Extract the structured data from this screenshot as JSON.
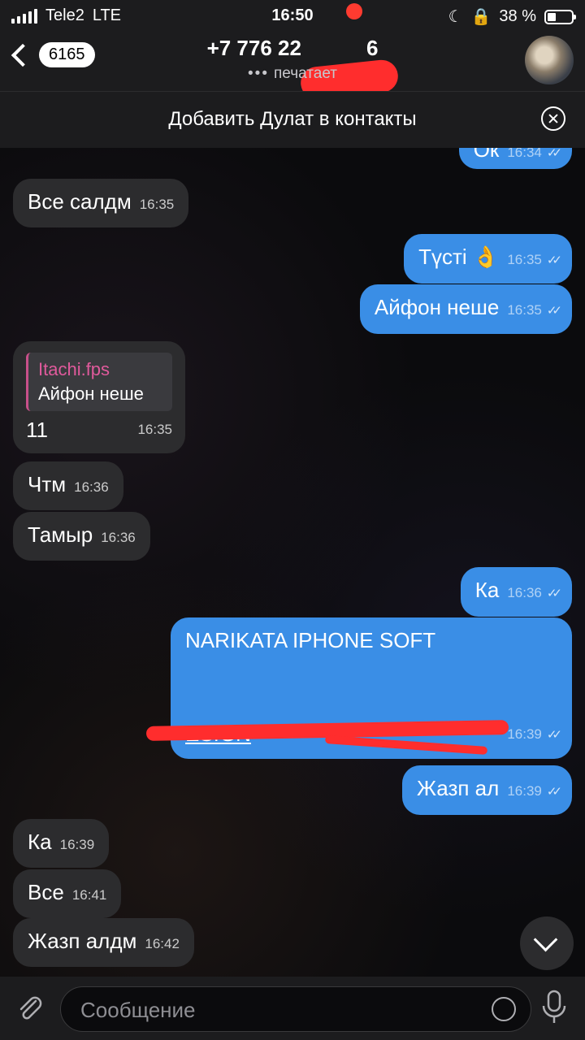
{
  "status_bar": {
    "carrier": "Tele2",
    "network": "LTE",
    "time": "16:50",
    "battery": "38 %"
  },
  "header": {
    "back_count": "6165",
    "title": "+7 776 22",
    "title_suffix": "6",
    "subtitle_dots": "•••",
    "subtitle": "печатает"
  },
  "contact_bar": {
    "label": "Добавить Дулат в контакты"
  },
  "messages": [
    {
      "text": "Ок",
      "time": "16:34"
    },
    {
      "text": "Все салдм",
      "time": "16:35"
    },
    {
      "text": "Түсті 👌",
      "time": "16:35"
    },
    {
      "text": "Айфон неше",
      "time": "16:35"
    },
    {
      "reply_author": "Itachi.fps",
      "reply_text": "Айфон неше",
      "text": "11",
      "time": "16:35"
    },
    {
      "text": "Чтм",
      "time": "16:36"
    },
    {
      "text": "Тамыр",
      "time": "16:36"
    },
    {
      "text": "Ка",
      "time": "16:36"
    },
    {
      "text": "NARIKATA IPHONE SOFT",
      "link_text": "ESIGN",
      "time": "16:39"
    },
    {
      "text": "Жазп ал",
      "time": "16:39"
    },
    {
      "text": "Ка",
      "time": "16:39"
    },
    {
      "text": "Все",
      "time": "16:41"
    },
    {
      "text": "Жазп алдм",
      "time": "16:42"
    }
  ],
  "input": {
    "placeholder": "Сообщение"
  },
  "colors": {
    "outgoing": "#3a8ee6",
    "incoming": "#2c2c2e",
    "redaction": "#ff2d2d"
  }
}
